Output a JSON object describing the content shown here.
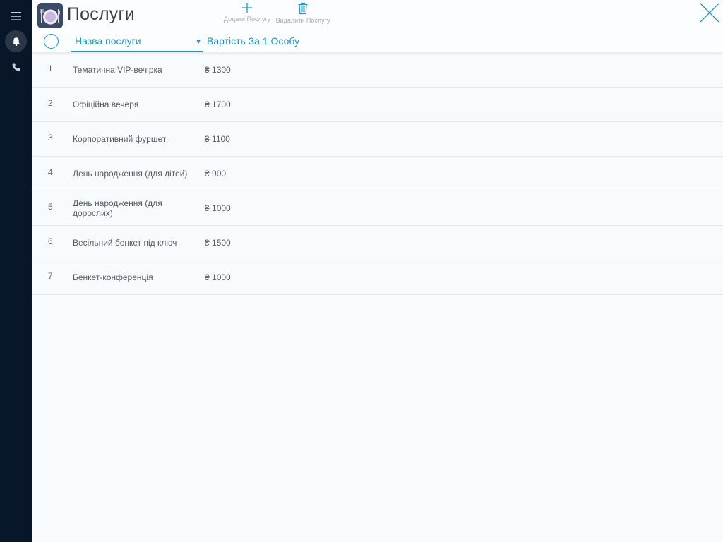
{
  "header": {
    "title": "Послуги",
    "add_label": "Додати Послугу",
    "delete_label": "Видалити Послугу"
  },
  "columns": {
    "name": "Назва послуги",
    "price": "Вартість За 1 Особу"
  },
  "currency": "₴",
  "services": [
    {
      "num": "1",
      "name": "Тематична VIP-вечірка",
      "price": "1300"
    },
    {
      "num": "2",
      "name": "Офіційна вечеря",
      "price": "1700"
    },
    {
      "num": "3",
      "name": "Корпоративний фуршет",
      "price": "1100"
    },
    {
      "num": "4",
      "name": "День народження (для дітей)",
      "price": "900"
    },
    {
      "num": "5",
      "name": "День народження (для дорослих)",
      "price": "1000"
    },
    {
      "num": "6",
      "name": "Весільний бенкет під ключ",
      "price": "1500"
    },
    {
      "num": "7",
      "name": "Бенкет-конференція",
      "price": "1000"
    }
  ],
  "icons": {
    "sidebar": [
      "menu-icon",
      "bell-icon",
      "phone-icon"
    ],
    "toolbar": [
      "plus-icon",
      "trash-icon"
    ],
    "close": "close-icon",
    "app": "plate-cutlery-icon"
  },
  "colors": {
    "accent": "#1e95c7",
    "sidebar_bg": "#08162a",
    "page_bg": "#f7fbfd"
  }
}
